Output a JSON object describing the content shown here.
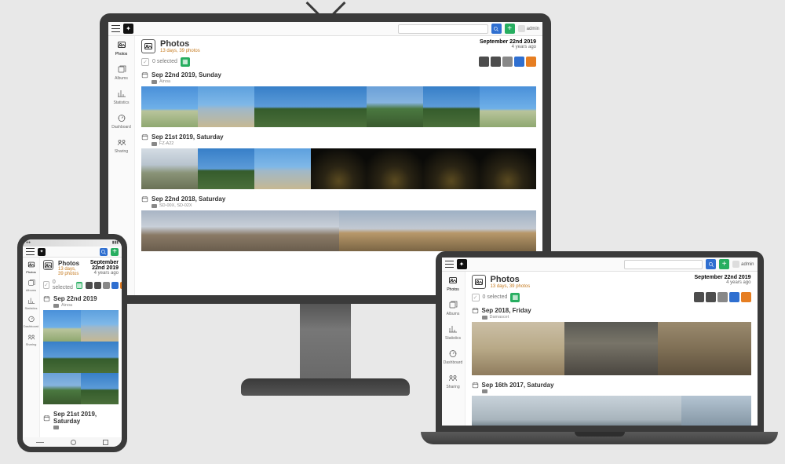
{
  "app": {
    "logo_glyph": "✦",
    "search_placeholder": "",
    "user_label": "admin"
  },
  "sidebar": {
    "items": [
      {
        "label": "Photos",
        "icon": "photos-icon"
      },
      {
        "label": "Albums",
        "icon": "albums-icon"
      },
      {
        "label": "Statistics",
        "icon": "stats-icon"
      },
      {
        "label": "Dashboard",
        "icon": "dashboard-icon"
      },
      {
        "label": "Sharing",
        "icon": "sharing-icon"
      }
    ]
  },
  "page": {
    "title": "Photos",
    "subtitle": "13 days, 39 photos",
    "date_label": "September 22nd 2019",
    "ago_label": "4 years ago",
    "selected_label": "0 selected"
  },
  "desktop_groups": [
    {
      "date": "Sep 22nd 2019, Sunday",
      "camera": "Ainoa",
      "thumbs": [
        "sky",
        "coast",
        "palm",
        "palm",
        "hill",
        "palm",
        "sky"
      ]
    },
    {
      "date": "Sep 21st 2019, Saturday",
      "camera": "FZ-A22",
      "thumbs": [
        "bridge",
        "palm",
        "coast",
        "night",
        "night",
        "night",
        "night"
      ]
    },
    {
      "date": "Sep 22nd 2018, Saturday",
      "camera": "SD-00X, SD-02X",
      "thumbs": [
        "city",
        "tower"
      ]
    }
  ],
  "laptop_groups": [
    {
      "date": "Sep 2018, Friday",
      "camera": "Damascet",
      "thumbs": [
        "zoo",
        "zoo2",
        "zoo3"
      ]
    },
    {
      "date": "Sep 16th 2017, Saturday",
      "camera": "",
      "thumbs": [
        "sea",
        "sea",
        "sea",
        "sea2"
      ]
    }
  ],
  "phone_groups": [
    {
      "date": "Sep 22nd 2019",
      "camera": "Ainoa",
      "thumbs": [
        "sky",
        "coast",
        "palm",
        "palm",
        "hill",
        "palm"
      ]
    },
    {
      "date": "Sep 21st 2019, Saturday",
      "camera": "",
      "thumbs": []
    }
  ]
}
